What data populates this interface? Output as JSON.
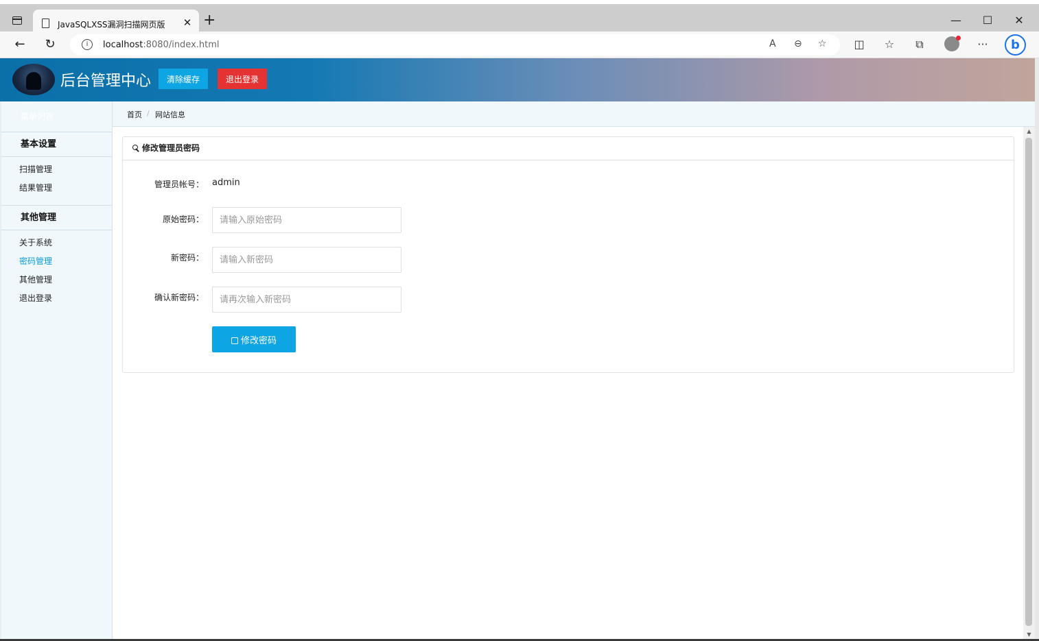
{
  "browser": {
    "tab_title": "JavaSQLXSS漏洞扫描网页版",
    "tab_close": "✕",
    "new_tab": "+",
    "url_host": "localhost",
    "url_rest": ":8080/index.html",
    "window_minimize": "—",
    "window_maximize": "☐",
    "window_close": "✕",
    "icons": [
      "tab-actions-icon",
      "document-icon",
      "back-arrow-icon",
      "refresh-icon",
      "info-icon",
      "read-aloud-icon",
      "zoom-out-icon",
      "add-favorite-icon",
      "split-screen-icon",
      "favorites-icon",
      "collections-icon",
      "profile-avatar-icon",
      "more-menu-icon",
      "bing-icon"
    ]
  },
  "header": {
    "title": "后台管理中心",
    "clear_cache": "清除缓存",
    "logout": "退出登录"
  },
  "sidebar": {
    "head": "菜单列表",
    "groups": [
      {
        "title": "基本设置",
        "items": [
          {
            "label": "扫描管理"
          },
          {
            "label": "结果管理"
          }
        ]
      },
      {
        "title": "其他管理",
        "items": [
          {
            "label": "关于系统"
          },
          {
            "label": "密码管理",
            "active": true
          },
          {
            "label": "其他管理"
          },
          {
            "label": "退出登录"
          }
        ]
      }
    ]
  },
  "breadcrumb": {
    "home": "首页",
    "separator": "/",
    "current": "网站信息"
  },
  "panel": {
    "title": "修改管理员密码",
    "account_label": "管理员帐号：",
    "account_value": "admin",
    "old_pwd_label": "原始密码：",
    "old_pwd_placeholder": "请输入原始密码",
    "new_pwd_label": "新密码：",
    "new_pwd_placeholder": "请输入新密码",
    "confirm_pwd_label": "确认新密码：",
    "confirm_pwd_placeholder": "请再次输入新密码",
    "submit": "修改密码"
  },
  "colors": {
    "accent_blue": "#0ea5e4",
    "danger_red": "#e53333",
    "sidebar_bg": "#f1f8fc",
    "active_link": "#0a9cd6"
  }
}
